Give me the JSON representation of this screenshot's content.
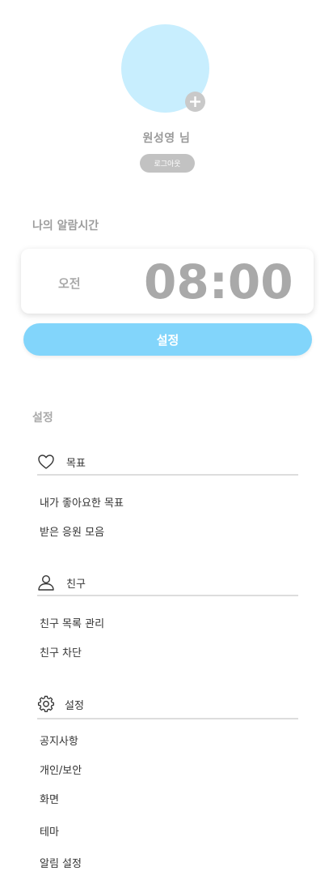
{
  "profile": {
    "name": "원성영 님",
    "logout_label": "로그아웃",
    "add_icon": "plus-icon"
  },
  "alarm": {
    "section_title": "나의 알람시간",
    "ampm": "오전",
    "time": "08:00",
    "set_label": "설정"
  },
  "settings": {
    "section_title": "설정",
    "sections": [
      {
        "icon": "heart-icon",
        "label": "목표",
        "items": [
          "내가 좋아요한 목표",
          "받은 응원 모음"
        ]
      },
      {
        "icon": "user-icon",
        "label": "친구",
        "items": [
          "친구 목록 관리",
          "친구 차단"
        ]
      },
      {
        "icon": "gear-icon",
        "label": "설정",
        "items": [
          "공지사항",
          "개인/보안",
          "화면",
          "테마",
          "알림 설정"
        ]
      }
    ]
  },
  "colors": {
    "accent": "#82d5fb",
    "avatar": "#c8eefe",
    "muted_text": "#a9a9a9"
  }
}
